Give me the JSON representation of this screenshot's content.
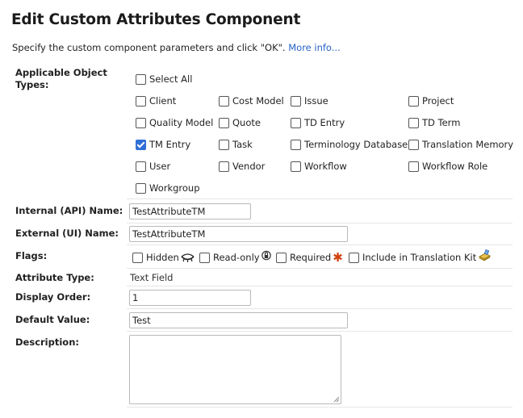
{
  "header": {
    "title": "Edit Custom Attributes Component",
    "intro": "Specify the custom component parameters and click \"OK\".",
    "more_info": "More info..."
  },
  "labels": {
    "object_types": "Applicable Object Types:",
    "internal_name": "Internal (API) Name:",
    "external_name": "External (UI) Name:",
    "flags": "Flags:",
    "attribute_type": "Attribute Type:",
    "display_order": "Display Order:",
    "default_value": "Default Value:",
    "description": "Description:"
  },
  "object_types": {
    "select_all": {
      "label": "Select All",
      "checked": false
    },
    "items": [
      {
        "label": "Client",
        "checked": false
      },
      {
        "label": "Cost Model",
        "checked": false
      },
      {
        "label": "Issue",
        "checked": false
      },
      {
        "label": "Project",
        "checked": false
      },
      {
        "label": "Quality Model",
        "checked": false
      },
      {
        "label": "Quote",
        "checked": false
      },
      {
        "label": "TD Entry",
        "checked": false
      },
      {
        "label": "TD Term",
        "checked": false
      },
      {
        "label": "TM Entry",
        "checked": true
      },
      {
        "label": "Task",
        "checked": false
      },
      {
        "label": "Terminology Database",
        "checked": false
      },
      {
        "label": "Translation Memory",
        "checked": false
      },
      {
        "label": "User",
        "checked": false
      },
      {
        "label": "Vendor",
        "checked": false
      },
      {
        "label": "Workflow",
        "checked": false
      },
      {
        "label": "Workflow Role",
        "checked": false
      },
      {
        "label": "Workgroup",
        "checked": false
      }
    ]
  },
  "fields": {
    "internal_name": "TestAttributeTM",
    "external_name": "TestAttributeTM",
    "attribute_type": "Text Field",
    "display_order": "1",
    "default_value": "Test",
    "description": ""
  },
  "flags": [
    {
      "label": "Hidden",
      "checked": false,
      "icon": "eye-closed-icon"
    },
    {
      "label": "Read-only",
      "checked": false,
      "icon": "lock-icon"
    },
    {
      "label": "Required",
      "checked": false,
      "icon": "required-asterisk-icon"
    },
    {
      "label": "Include in Translation Kit",
      "checked": false,
      "icon": "translation-kit-icon"
    }
  ],
  "colors": {
    "link": "#2563c9",
    "checked": "#2f6fd6",
    "required": "#d1420e"
  }
}
